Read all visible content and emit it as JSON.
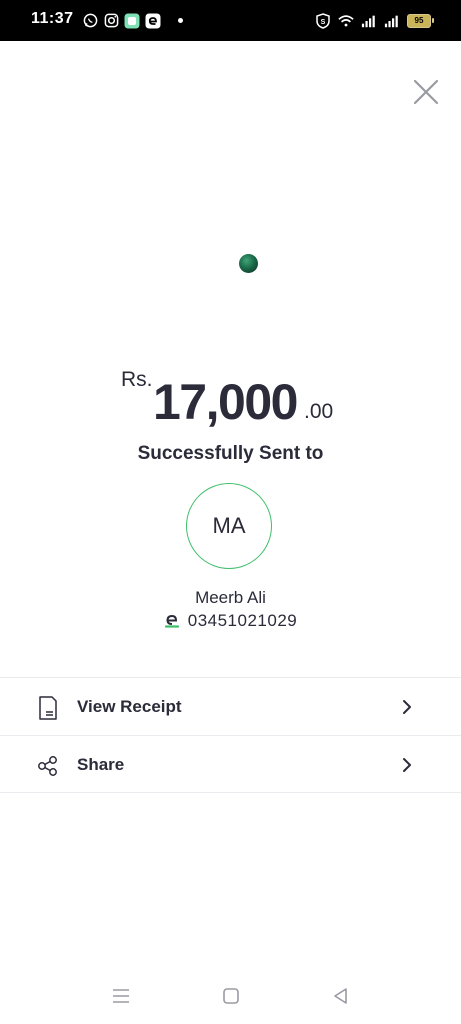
{
  "status_bar": {
    "time": "11:37",
    "left_icons": [
      "whatsapp-icon",
      "instagram-icon",
      "chat-app-icon",
      "easypaisa-icon",
      "notification-dot"
    ],
    "right_icons": [
      "vpn-icon",
      "wifi-icon",
      "signal-icon",
      "signal-icon"
    ],
    "battery": "95"
  },
  "header": {
    "close_icon": "close-icon"
  },
  "transaction": {
    "currency": "Rs.",
    "amount": "17,000",
    "decimal": ".00",
    "status_text": "Successfully Sent to"
  },
  "recipient": {
    "initials": "MA",
    "name": "Meerb Ali",
    "number": "03451021029",
    "wallet_icon": "easypaisa-logo-icon"
  },
  "actions": [
    {
      "label": "View Receipt",
      "icon": "receipt-icon"
    },
    {
      "label": "Share",
      "icon": "share-icon"
    }
  ],
  "colors": {
    "accent_green": "#3fbf6a",
    "text_dark": "#2b2b3a",
    "divider": "#ececf0"
  }
}
